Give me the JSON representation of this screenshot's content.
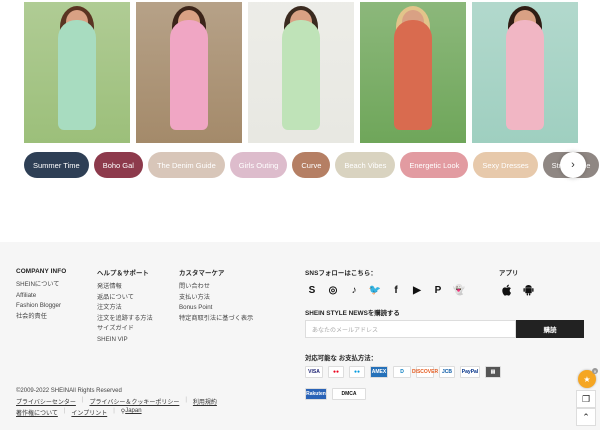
{
  "photos": [
    {
      "bg": "#9cbf7a",
      "outfit": "#a8dcc0",
      "hair": "#5a3422"
    },
    {
      "bg": "#a48a6a",
      "outfit": "#f0a6c4",
      "hair": "#3b2419"
    },
    {
      "bg": "#e8e8e2",
      "outfit": "#bfe3b8",
      "hair": "#3a2a1f"
    },
    {
      "bg": "#6fa65a",
      "outfit": "#d96b4f",
      "hair": "#e2c48a"
    },
    {
      "bg": "#9fcfc0",
      "outfit": "#f1b6c4",
      "hair": "#2f1d14"
    }
  ],
  "categories": [
    {
      "label": "Summer Time",
      "color": "#2e3f55"
    },
    {
      "label": "Boho Gal",
      "color": "#8d3a4c"
    },
    {
      "label": "The Denim Guide",
      "color": "#d8c6b9"
    },
    {
      "label": "Girls Outing",
      "color": "#ddbccc"
    },
    {
      "label": "Curve",
      "color": "#b57f64"
    },
    {
      "label": "Beach Vibes",
      "color": "#d9d3c0"
    },
    {
      "label": "Energetic Look",
      "color": "#e29ba1"
    },
    {
      "label": "Sexy Dresses",
      "color": "#e7c9ab"
    },
    {
      "label": "Street Style",
      "color": "#8f8783"
    }
  ],
  "footer": {
    "company": {
      "title": "COMPANY INFO",
      "links": [
        "SHEINについて",
        "Affiliate",
        "Fashion Blogger",
        "社会的責任"
      ]
    },
    "help": {
      "title": "ヘルプ＆サポート",
      "links": [
        "発送情報",
        "返品について",
        "注文方法",
        "注文を追跡する方法",
        "サイズガイド",
        "SHEIN VIP"
      ]
    },
    "customer": {
      "title": "カスタマーケア",
      "links": [
        "問い合わせ",
        "支払い方法",
        "Bonus Point",
        "特定商取引法に基づく表示"
      ]
    },
    "sns_title": "SNSフォローはこちら：",
    "sns_icons": [
      "S",
      "◎",
      "♪",
      "🐦",
      "f",
      "▶",
      "P",
      "👻"
    ],
    "app_title": "アプリ",
    "news_title": "SHEIN STYLE NEWSを購読する",
    "email_placeholder": "あなたのメールアドレス",
    "subscribe_label": "購読",
    "pay_title": "対応可能な お支払方法：",
    "payments_row1": [
      {
        "label": "VISA",
        "bg": "#fff",
        "fg": "#1a1f71",
        "w": 18
      },
      {
        "label": "●●",
        "bg": "#fff",
        "fg": "#eb001b",
        "w": 16
      },
      {
        "label": "●●",
        "bg": "#fff",
        "fg": "#0099df",
        "w": 16
      },
      {
        "label": "AMEX",
        "bg": "#2671b9",
        "fg": "#fff",
        "w": 18
      },
      {
        "label": "D",
        "bg": "#fff",
        "fg": "#0079be",
        "w": 18
      },
      {
        "label": "DISCOVER",
        "bg": "#fff",
        "fg": "#e55c20",
        "w": 18
      },
      {
        "label": "JCB",
        "bg": "#fff",
        "fg": "#0b5aa6",
        "w": 16
      },
      {
        "label": "PayPal",
        "bg": "#fff",
        "fg": "#003087",
        "w": 20
      },
      {
        "label": "▤",
        "bg": "#555",
        "fg": "#fff",
        "w": 16
      }
    ],
    "payments_row2": [
      {
        "label": "Rakuten",
        "bg": "#2a63b7",
        "fg": "#fff",
        "w": 22
      },
      {
        "label": "DMCA",
        "bg": "#fff",
        "fg": "#111",
        "w": 34
      }
    ],
    "copyright": "©2009-2022 SHEINAll Rights Reserved",
    "legal_row1": [
      "プライバシーセンター",
      "プライバシー＆クッキーポリシー",
      "利用規約"
    ],
    "legal_row2": [
      "著作権について",
      "インプリント"
    ],
    "locale": "Japan"
  }
}
